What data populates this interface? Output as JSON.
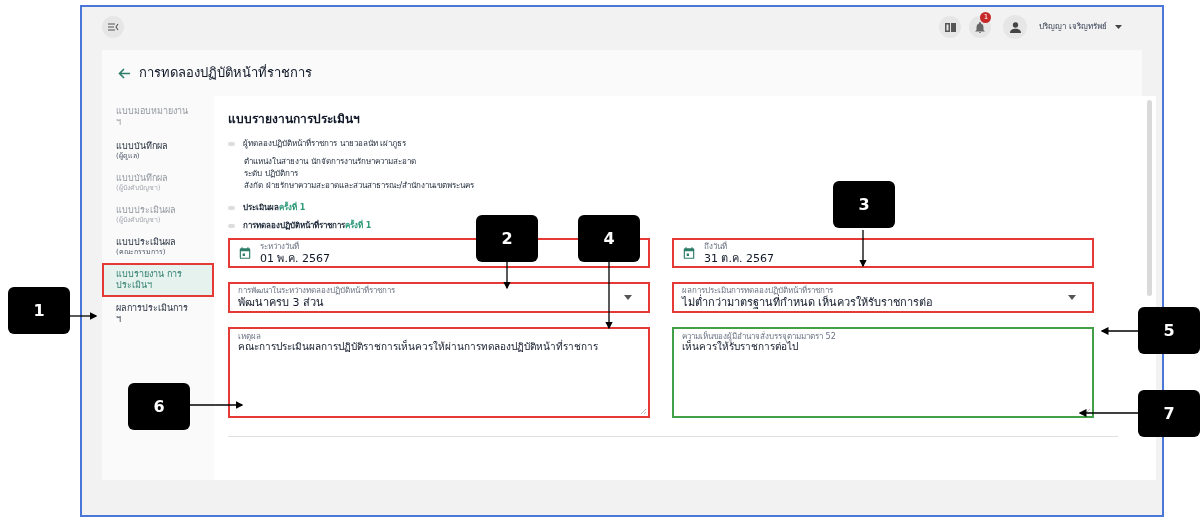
{
  "top_bar": {
    "notification_count": "1",
    "user_name": "ปริญญา เจริญทรัพย์"
  },
  "page": {
    "title": "การทดลองปฏิบัติหน้าที่ราชการ"
  },
  "sidebar": {
    "items": [
      {
        "label": "แบบมอบหมายงาน ฯ",
        "selected": false,
        "disabled": true,
        "highlight": false
      },
      {
        "label": "แบบบันทึกผล",
        "sublabel": "(ผู้ดูแล)",
        "selected": false,
        "disabled": false,
        "highlight": false
      },
      {
        "label": "แบบบันทึกผล",
        "sublabel": "(ผู้บังคับบัญชา)",
        "selected": false,
        "disabled": true,
        "highlight": false
      },
      {
        "label": "แบบประเมินผล",
        "sublabel": "(ผู้บังคับบัญชา)",
        "selected": false,
        "disabled": true,
        "highlight": false
      },
      {
        "label": "แบบประเมินผล",
        "sublabel": "(คณะกรรมการ)",
        "selected": false,
        "disabled": false,
        "highlight": false
      },
      {
        "label": "แบบรายงาน การประเมินฯ",
        "selected": true,
        "disabled": false,
        "highlight": true
      },
      {
        "label": "ผลการประเมินการ ฯ",
        "selected": false,
        "disabled": false,
        "highlight": false
      }
    ]
  },
  "report": {
    "title": "แบบรายงานการประเมินฯ",
    "trainee": "ผู้ทดลองปฏิบัติหน้าที่ราชการ นายวอลนัท เผ่าภูธร",
    "details": [
      "ตำแหน่งในสายงาน นักจัดการงานรักษาความสะอาด",
      "ระดับ ปฏิบัติการ",
      "สังกัด ฝ่ายรักษาความสะอาดและสวนสาธารณะ/สำนักงานเขตพระนคร"
    ],
    "rounds": [
      {
        "label": "ประเมินผล",
        "round": "ครั้งที่ 1"
      },
      {
        "label": "การทดลองปฏิบัติหน้าที่ราชการ",
        "round": "ครั้งที่ 1"
      }
    ]
  },
  "fields": [
    {
      "kind": "date",
      "label": "ระหว่างวันที่",
      "value": "01 พ.ค. 2567",
      "color": "#e53935"
    },
    {
      "kind": "date",
      "label": "ถึงวันที่",
      "value": "31 ต.ค. 2567",
      "color": "#e53935"
    },
    {
      "kind": "select",
      "label": "การพัฒนาในระหว่างทดลองปฏิบัติหน้าที่ราชการ",
      "value": "พัฒนาครบ 3 ส่วน",
      "color": "#e53935"
    },
    {
      "kind": "select",
      "label": "ผลการประเมินการทดลองปฏิบัติหน้าที่ราชการ",
      "value": "ไม่ต่ำกว่ามาตรฐานที่กำหนด เห็นควรให้รับราชการต่อ",
      "color": "#e53935"
    },
    {
      "kind": "textarea",
      "label": "เหตุผล",
      "value": "คณะการประเมินผลการปฏิบัติราชการเห็นควรให้ผ่านการทดลองปฏิบัติหน้าที่ราชการ",
      "color": "#e53935"
    },
    {
      "kind": "textarea",
      "label": "ความเห็นของผู้มีอำนาจสั่งบรรจุตามมาตรา 52",
      "value": "เห็นควรให้รับราชการต่อไป",
      "color": "#43a047"
    }
  ],
  "callouts": [
    "1",
    "2",
    "3",
    "4",
    "5",
    "6",
    "7"
  ]
}
